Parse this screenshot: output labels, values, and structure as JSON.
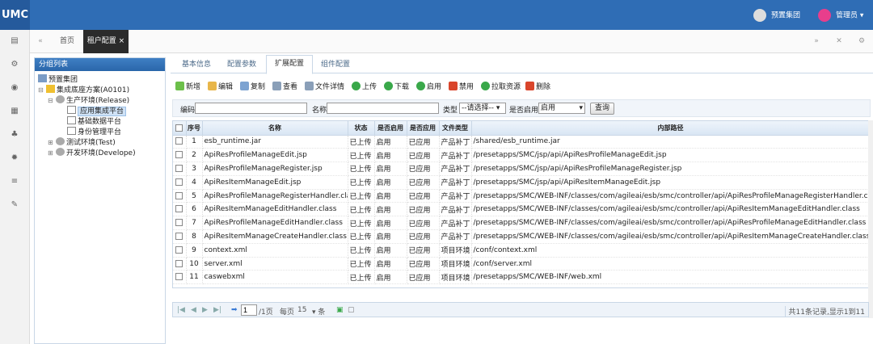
{
  "app": {
    "logo": "UMC",
    "org_user": "预置集团",
    "admin_user": "管理员 ▾"
  },
  "nav_tabs": {
    "home": "首页",
    "active": "租户配置 ×"
  },
  "left_panel": {
    "title": "分组列表",
    "tree": [
      {
        "label": "预置集团",
        "toggle": ""
      },
      {
        "label": "集成底座方案(A0101)",
        "toggle": "⊟"
      },
      {
        "label": "生产环境(Release)",
        "toggle": "⊟"
      },
      {
        "label": "应用集成平台",
        "toggle": ""
      },
      {
        "label": "基础数据平台",
        "toggle": ""
      },
      {
        "label": "身份管理平台",
        "toggle": ""
      },
      {
        "label": "测试环境(Test)",
        "toggle": "⊞"
      },
      {
        "label": "开发环境(Develope)",
        "toggle": "⊞"
      }
    ]
  },
  "sub_tabs": [
    "基本信息",
    "配置参数",
    "扩展配置",
    "组件配置"
  ],
  "toolbar": [
    "新增",
    "编辑",
    "复制",
    "查看",
    "文件详情",
    "上传",
    "下载",
    "启用",
    "禁用",
    "拉取资源",
    "删除"
  ],
  "search": {
    "code_label": "编码",
    "code_value": "",
    "name_label": "名称",
    "name_value": "",
    "type_label": "类型",
    "type_value": "--请选择-- ▾",
    "enable_label": "是否启用",
    "enable_value": "启用",
    "query_button": "查询"
  },
  "table": {
    "headers": [
      "序号",
      "名称",
      "状态",
      "是否启用",
      "是否应用",
      "文件类型",
      "内部路径"
    ],
    "rows": [
      [
        "1",
        "esb_runtime.jar",
        "已上传",
        "启用",
        "已应用",
        "产品补丁",
        "/shared/esb_runtime.jar"
      ],
      [
        "2",
        "ApiResProfileManageEdit.jsp",
        "已上传",
        "启用",
        "已应用",
        "产品补丁",
        "/presetapps/SMC/jsp/api/ApiResProfileManageEdit.jsp"
      ],
      [
        "3",
        "ApiResProfileManageRegister.jsp",
        "已上传",
        "启用",
        "已应用",
        "产品补丁",
        "/presetapps/SMC/jsp/api/ApiResProfileManageRegister.jsp"
      ],
      [
        "4",
        "ApiResItemManageEdit.jsp",
        "已上传",
        "启用",
        "已应用",
        "产品补丁",
        "/presetapps/SMC/jsp/api/ApiResItemManageEdit.jsp"
      ],
      [
        "5",
        "ApiResProfileManageRegisterHandler.class",
        "已上传",
        "启用",
        "已应用",
        "产品补丁",
        "/presetapps/SMC/WEB-INF/classes/com/agileai/esb/smc/controller/api/ApiResProfileManageRegisterHandler.class"
      ],
      [
        "6",
        "ApiResItemManageEditHandler.class",
        "已上传",
        "启用",
        "已应用",
        "产品补丁",
        "/presetapps/SMC/WEB-INF/classes/com/agileai/esb/smc/controller/api/ApiResItemManageEditHandler.class"
      ],
      [
        "7",
        "ApiResProfileManageEditHandler.class",
        "已上传",
        "启用",
        "已应用",
        "产品补丁",
        "/presetapps/SMC/WEB-INF/classes/com/agileai/esb/smc/controller/api/ApiResProfileManageEditHandler.class"
      ],
      [
        "8",
        "ApiResItemManageCreateHandler.class",
        "已上传",
        "启用",
        "已应用",
        "产品补丁",
        "/presetapps/SMC/WEB-INF/classes/com/agileai/esb/smc/controller/api/ApiResItemManageCreateHandler.class"
      ],
      [
        "9",
        "context.xml",
        "已上传",
        "启用",
        "已应用",
        "项目环境",
        "/conf/context.xml"
      ],
      [
        "10",
        "server.xml",
        "已上传",
        "启用",
        "已应用",
        "项目环境",
        "/conf/server.xml"
      ],
      [
        "11",
        "caswebxml",
        "已上传",
        "启用",
        "已应用",
        "项目环境",
        "/presetapps/SMC/WEB-INF/web.xml"
      ]
    ]
  },
  "pager": {
    "page": "1",
    "of": "/1页",
    "per_page_label": "每页",
    "per_page": "15",
    "per_page_unit": "▾ 条",
    "summary": "共11条记录,显示1到11"
  },
  "colors": {
    "topbar": "#2f6db5",
    "accent": "#2a66aa"
  }
}
